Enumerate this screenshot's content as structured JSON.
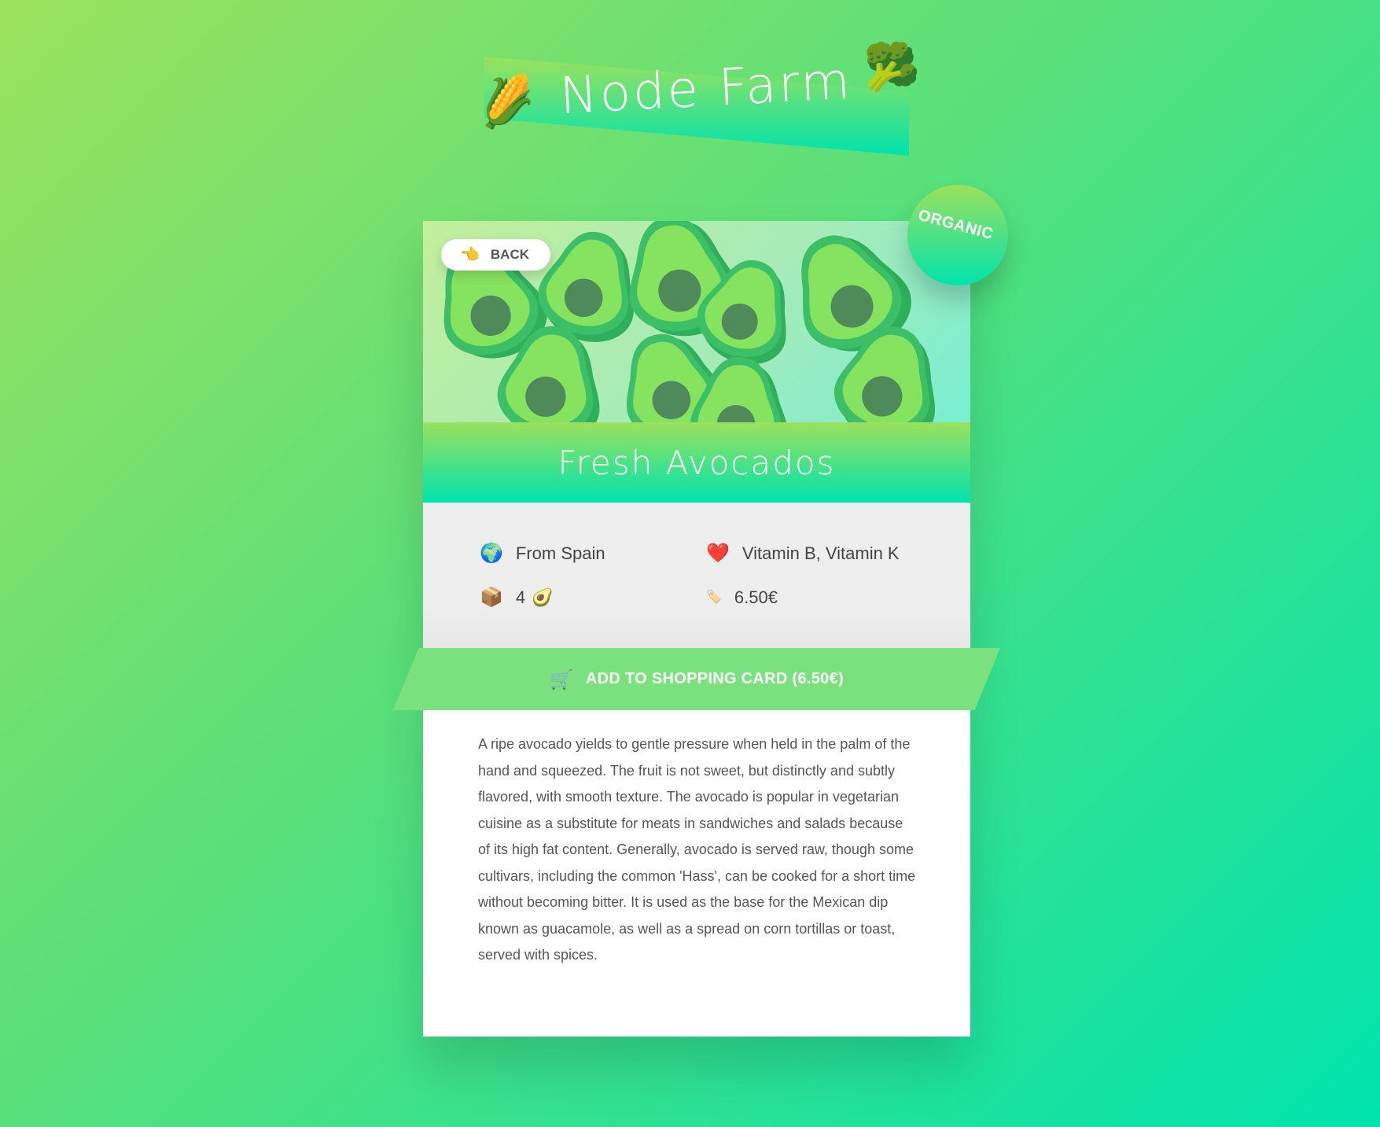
{
  "brand": {
    "title": "Node Farm",
    "left_icon": "🌽",
    "right_icon": "🥦"
  },
  "product": {
    "name": "Fresh Avocados",
    "image_icon": "avocado-illustration",
    "organic_badge": "Organic",
    "from_icon": "🌍",
    "from": "From Spain",
    "nutrients_icon": "❤️",
    "nutrients": "Vitamin B, Vitamin K",
    "quantity_icon": "📦",
    "quantity": "4",
    "quantity_unit_icon": "🥑",
    "price_icon": "🏷️",
    "price": "6.50€",
    "description": "A ripe avocado yields to gentle pressure when held in the palm of the hand and squeezed. The fruit is not sweet, but distinctly and subtly flavored, with smooth texture. The avocado is popular in vegetarian cuisine as a substitute for meats in sandwiches and salads because of its high fat content. Generally, avocado is served raw, though some cultivars, including the common 'Hass', can be cooked for a short time without becoming bitter. It is used as the base for the Mexican dip known as guacamole, as well as a spread on corn tortillas or toast, served with spices."
  },
  "nav": {
    "back_icon": "👈",
    "back_label": "Back"
  },
  "cart": {
    "icon": "🛒",
    "label": "Add to shopping card (6.50€)"
  },
  "colors": {
    "gradient_start": "#9be15d",
    "gradient_end": "#00e3ae",
    "cart_button": "#79e27e",
    "details_bg": "#eeeeee",
    "text": "#555555"
  }
}
